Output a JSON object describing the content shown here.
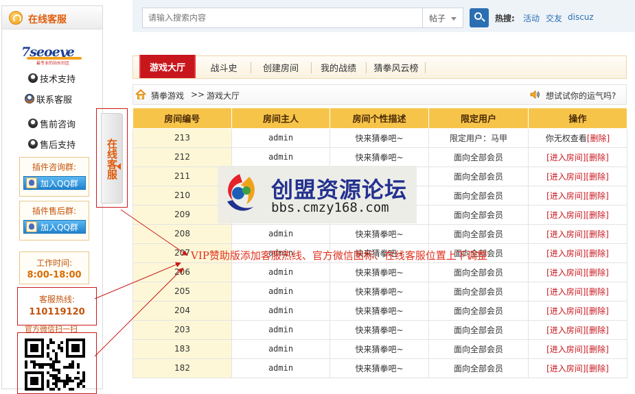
{
  "colors": {
    "accent_red": "#c8161d",
    "header_gold": "#f7c44a",
    "link_blue": "#2b6fb3",
    "orange": "#e25d0c",
    "annotation_red": "#e0301e"
  },
  "sidebar": {
    "title": "在线客服",
    "links": [
      {
        "label": "技术支持",
        "icon": "person-icon"
      },
      {
        "label": "联系客服",
        "icon": "qq-penguin-icon"
      },
      {
        "label": "售前咨询",
        "icon": "person-icon"
      },
      {
        "label": "售后支持",
        "icon": "person-icon"
      }
    ],
    "groups": [
      {
        "label": "插件咨询群:",
        "button": "加入QQ群"
      },
      {
        "label": "插件售后群:",
        "button": "加入QQ群"
      }
    ],
    "work_label": "工作时间:",
    "work_hours": "8:00-18:00",
    "hotline_label": "客服热线:",
    "hotline": "110119120",
    "wechat_label": "官方微信扫一扫"
  },
  "float_tab": {
    "label": "在线客服"
  },
  "search": {
    "placeholder": "请输入搜索内容",
    "type": "帖子",
    "hot_title": "热搜:",
    "hot_keywords": [
      "活动",
      "交友",
      "discuz"
    ]
  },
  "nav": {
    "tabs": [
      "游戏大厅",
      "战斗史",
      "创建房间",
      "我的战绩",
      "猜拳风云榜"
    ]
  },
  "breadcrumb": {
    "items": [
      "猜拳游戏",
      ">>",
      "游戏大厅"
    ],
    "luck_link": "想试试你的运气吗?"
  },
  "table": {
    "headers": [
      "房间编号",
      "房间主人",
      "房间个性描述",
      "限定用户",
      "操作"
    ],
    "rows": [
      {
        "id": "213",
        "owner": "admin",
        "desc": "快来猜拳吧~",
        "limit": "限定用户：马甲",
        "action_text": "你无权查看",
        "enter": "",
        "del": "[删除]"
      },
      {
        "id": "212",
        "owner": "admin",
        "desc": "快来猜拳吧~",
        "limit": "面向全部会员",
        "action_text": "",
        "enter": "[进入房间]",
        "del": "[删除]"
      },
      {
        "id": "211",
        "owner": "",
        "desc": "",
        "limit": "面向全部会员",
        "action_text": "",
        "enter": "[进入房间]",
        "del": "[删除]"
      },
      {
        "id": "210",
        "owner": "",
        "desc": "",
        "limit": "面向全部会员",
        "action_text": "",
        "enter": "[进入房间]",
        "del": "[删除]"
      },
      {
        "id": "209",
        "owner": "",
        "desc": "",
        "limit": "面向全部会员",
        "action_text": "",
        "enter": "[进入房间]",
        "del": "[删除]"
      },
      {
        "id": "208",
        "owner": "admin",
        "desc": "快来猜拳吧~",
        "limit": "面向全部会员",
        "action_text": "",
        "enter": "[进入房间]",
        "del": "[删除]"
      },
      {
        "id": "207",
        "owner": "admin",
        "desc": "快来猜拳吧~",
        "limit": "面向全部会员",
        "action_text": "",
        "enter": "[进入房间]",
        "del": "[删除]"
      },
      {
        "id": "206",
        "owner": "admin",
        "desc": "快来猜拳吧~",
        "limit": "面向全部会员",
        "action_text": "",
        "enter": "[进入房间]",
        "del": "[删除]"
      },
      {
        "id": "205",
        "owner": "admin",
        "desc": "快来猜拳吧~",
        "limit": "面向全部会员",
        "action_text": "",
        "enter": "[进入房间]",
        "del": "[删除]"
      },
      {
        "id": "204",
        "owner": "admin",
        "desc": "快来猜拳吧~",
        "limit": "面向全部会员",
        "action_text": "",
        "enter": "[进入房间]",
        "del": "[删除]"
      },
      {
        "id": "203",
        "owner": "admin",
        "desc": "快来猜拳吧~",
        "limit": "面向全部会员",
        "action_text": "",
        "enter": "[进入房间]",
        "del": "[删除]"
      },
      {
        "id": "183",
        "owner": "admin",
        "desc": "快来猜拳吧~",
        "limit": "面向全部会员",
        "action_text": "",
        "enter": "[进入房间]",
        "del": "[删除]"
      },
      {
        "id": "182",
        "owner": "admin",
        "desc": "快来猜拳吧~",
        "limit": "面向全部会员",
        "action_text": "",
        "enter": "[进入房间]",
        "del": "[删除]"
      }
    ]
  },
  "watermark": {
    "title": "创盟资源论坛",
    "url": "bbs.cmzy168.com"
  },
  "annotation": "VIP赞助版添加客服热线、官方微信图标、在线客服位置上下调整"
}
